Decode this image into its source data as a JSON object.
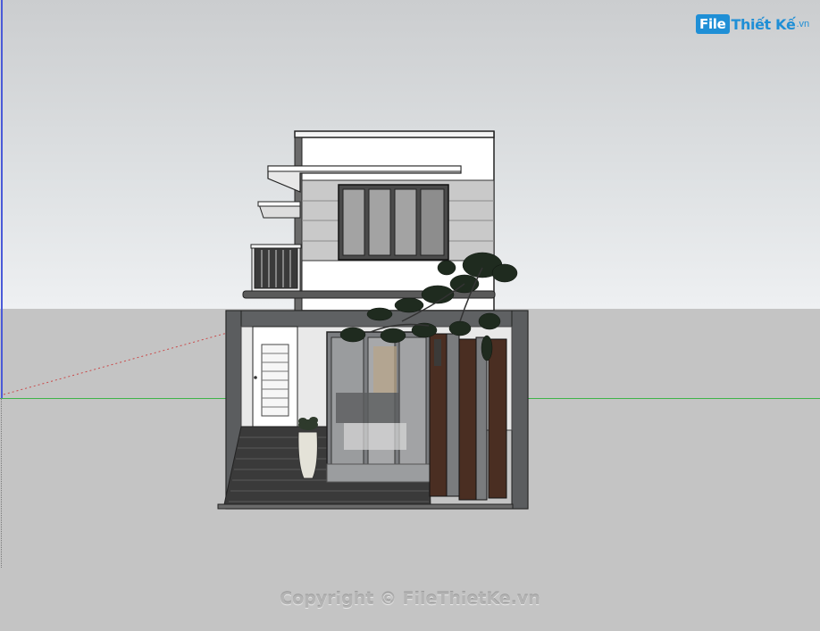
{
  "logo": {
    "badge": "File",
    "name": "Thiết Kế",
    "suffix": ".vn"
  },
  "watermark": "Copyright © FileThietKe.vn",
  "colors": {
    "sky": "#dfe2e4",
    "ground": "#c4c4c4",
    "axis_green": "#3fb34a",
    "axis_blue": "#4a5ad8",
    "brand_blue": "#1f8fd6"
  }
}
